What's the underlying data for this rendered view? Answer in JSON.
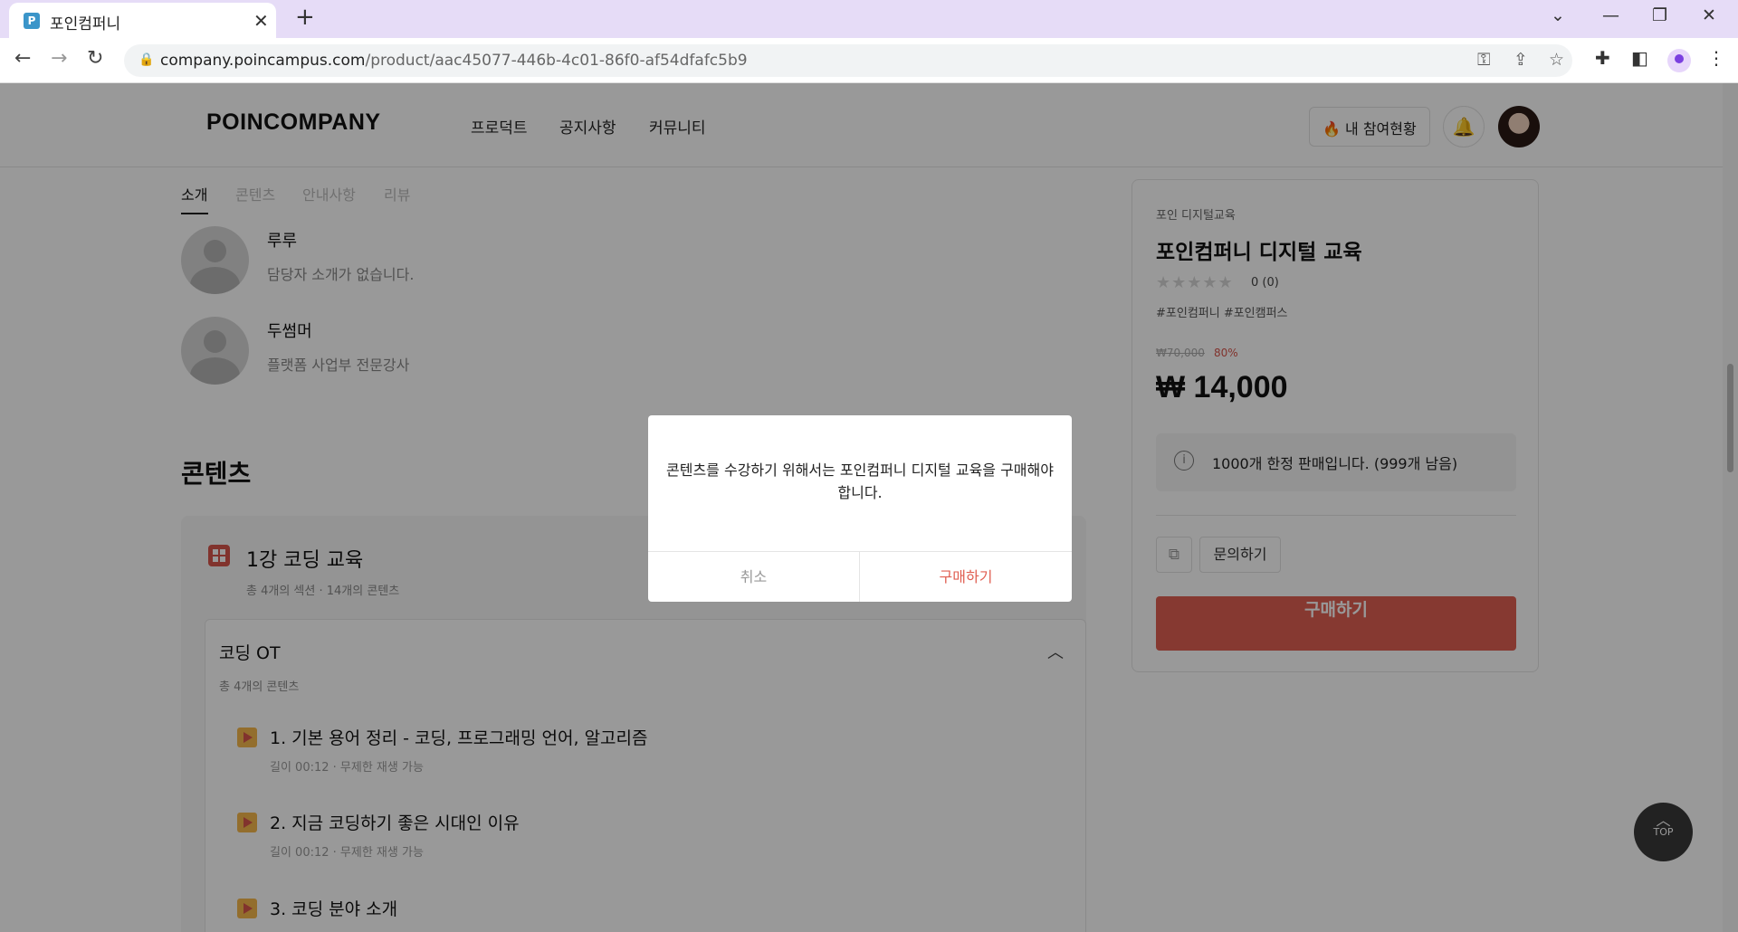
{
  "browser": {
    "tab_title": "포인컴퍼니",
    "favicon_letter": "P",
    "url_host": "company.poincampus.com",
    "url_path": "/product/aac45077-446b-4c01-86f0-af54dfafc5b9",
    "icons": [
      "back-icon",
      "forward-icon",
      "reload-icon",
      "lock-icon",
      "key-icon",
      "share-icon",
      "star-icon",
      "extensions-icon",
      "sidepanel-icon",
      "profile-icon",
      "menu-icon",
      "minimize-icon",
      "restore-icon",
      "close-icon",
      "tab-search-icon"
    ]
  },
  "header": {
    "logo": "POINCOMPANY",
    "nav": [
      "프로덕트",
      "공지사항",
      "커뮤니티"
    ],
    "my_status": "🔥 내 참여현황"
  },
  "subtabs": [
    "소개",
    "콘텐츠",
    "안내사항",
    "리뷰"
  ],
  "instructors": [
    {
      "name": "루루",
      "desc": "담당자 소개가 없습니다."
    },
    {
      "name": "두썸머",
      "desc": "플랫폼 사업부 전문강사"
    }
  ],
  "contents": {
    "section_title": "콘텐츠",
    "course": {
      "title": "1강 코딩 교육",
      "meta": "총 4개의 섹션 · 14개의 콘텐츠"
    },
    "section": {
      "title": "코딩 OT",
      "meta": "총 4개의 콘텐츠",
      "lessons": [
        {
          "title": "1. 기본 용어 정리 - 코딩, 프로그래밍 언어, 알고리즘",
          "meta": "길이 00:12 · 무제한 재생 가능"
        },
        {
          "title": "2. 지금 코딩하기 좋은 시대인 이유",
          "meta": "길이 00:12 · 무제한 재생 가능"
        },
        {
          "title": "3. 코딩 분야 소개",
          "meta": ""
        }
      ]
    }
  },
  "product": {
    "category": "포인 디지털교육",
    "title": "포인컴퍼니 디지털 교육",
    "stars": "★★★★★",
    "rating": "0 (0)",
    "tags": "#포인컴퍼니 #포인캠퍼스",
    "original_price": "₩70,000",
    "discount": "80%",
    "price": "₩ 14,000",
    "notice": "1000개 한정 판매입니다. (999개 남음)",
    "inquiry_label": "문의하기",
    "buy_label": "구매하기"
  },
  "top_button": "TOP",
  "modal": {
    "message": "콘텐츠를 수강하기 위해서는 포인컴퍼니 디지털 교육을 구매해야 합니다.",
    "cancel_label": "취소",
    "confirm_label": "구매하기"
  },
  "colors": {
    "accent": "#e05f52",
    "tabbar": "#e6dcf7",
    "overlay": "rgba(0,0,0,0.40)"
  }
}
